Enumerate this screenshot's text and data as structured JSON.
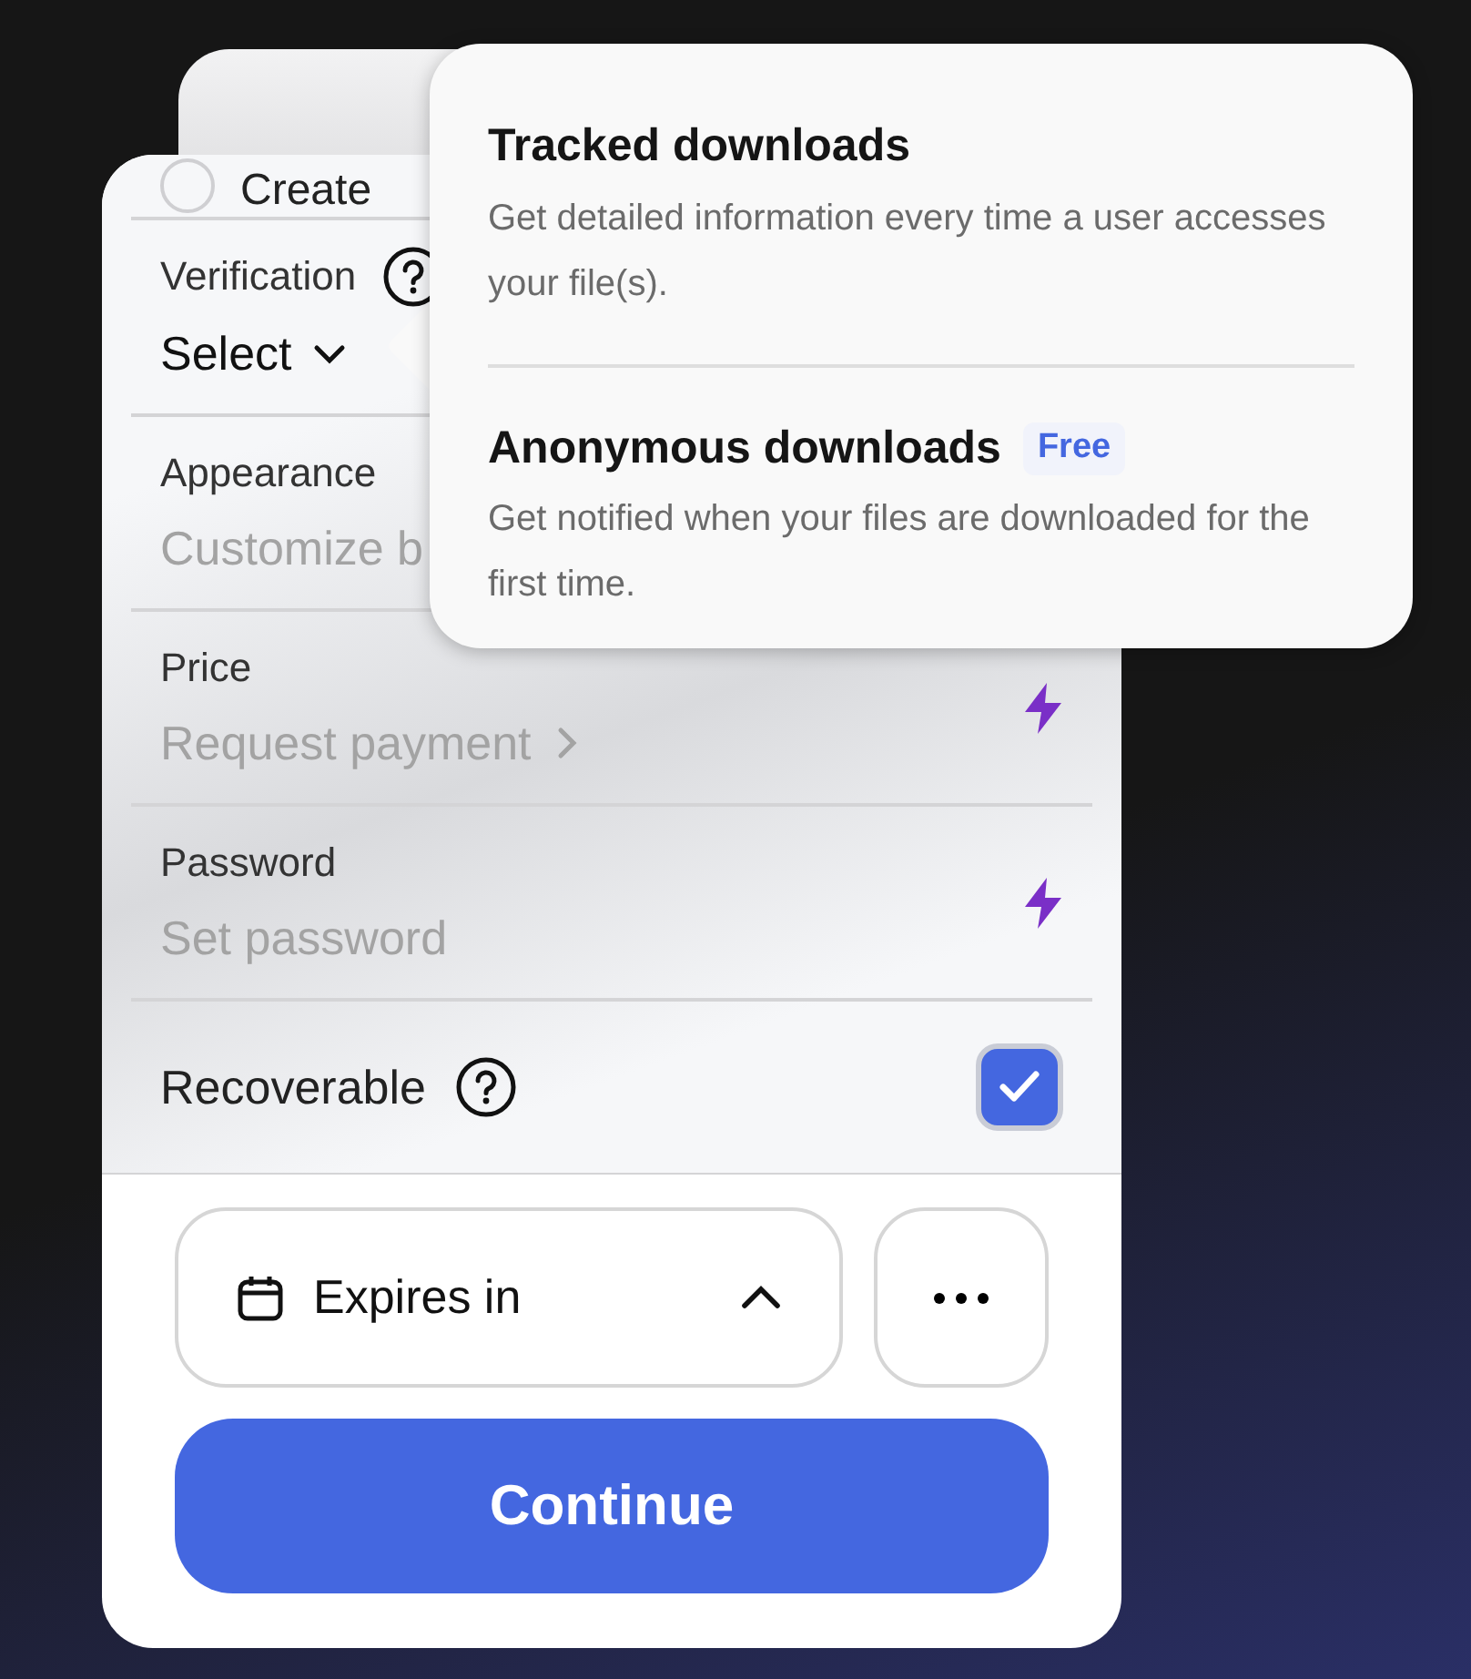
{
  "rows": [
    {
      "kind": "radio",
      "label": "Create",
      "checked": false
    },
    {
      "kind": "select",
      "label": "Verification",
      "value": "Select",
      "help": true
    },
    {
      "kind": "text",
      "label": "Appearance",
      "placeholder": "Customize b",
      "premium": false
    },
    {
      "kind": "link",
      "label": "Price",
      "placeholder": "Request payment",
      "premium": true
    },
    {
      "kind": "text",
      "label": "Password",
      "placeholder": "Set password",
      "premium": true
    },
    {
      "kind": "checkbox",
      "label": "Recoverable",
      "help": true,
      "checked": true
    }
  ],
  "expires": {
    "label": "Expires in",
    "expanded": true
  },
  "continue_button": "Continue",
  "popover": {
    "items": [
      {
        "title": "Tracked downloads",
        "description": "Get detailed information every time a user accesses your file(s)."
      },
      {
        "title": "Anonymous downloads",
        "badge": "Free",
        "description": "Get notified when your files are downloaded for the first time."
      }
    ]
  }
}
